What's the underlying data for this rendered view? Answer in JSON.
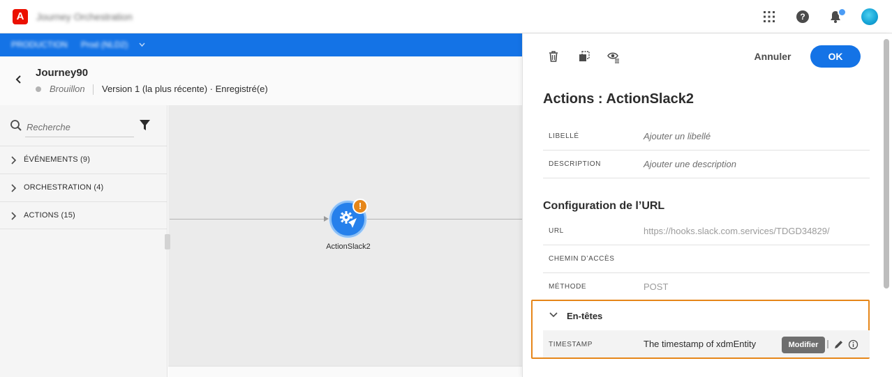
{
  "topbar": {
    "app_title": "Journey Orchestration",
    "help_glyph": "?"
  },
  "env_bar": {
    "environment": "PRODUCTION",
    "sandbox": "Prod (NLD2)"
  },
  "journey": {
    "name": "Journey90",
    "status": "Brouillon",
    "version": "Version 1 (la plus récente) · Enregistré(e)"
  },
  "palette": {
    "search_placeholder": "Recherche",
    "categories": [
      {
        "label": "ÉVÉNEMENTS (9)"
      },
      {
        "label": "ORCHESTRATION (4)"
      },
      {
        "label": "ACTIONS (15)"
      }
    ]
  },
  "canvas": {
    "node_label": "ActionSlack2",
    "node_warning_glyph": "!"
  },
  "panel": {
    "cancel_label": "Annuler",
    "ok_label": "OK",
    "title": "Actions : ActionSlack2",
    "fields": {
      "label_key": "LIBELLÉ",
      "label_value": "Ajouter un libellé",
      "description_key": "DESCRIPTION",
      "description_value": "Ajouter une description"
    },
    "url_section_title": "Configuration de l’URL",
    "url_fields": {
      "url_key": "URL",
      "url_value": "https://hooks.slack.com.services/TDGD34829/",
      "path_key": "CHEMIN D’ACCÈS",
      "path_value": "",
      "method_key": "MÉTHODE",
      "method_value": "POST"
    },
    "headers": {
      "title": "En-têtes",
      "key": "TIMESTAMP",
      "value": "The timestamp of xdmEntity",
      "tooltip": "Modifier"
    }
  },
  "colors": {
    "accent_blue": "#1473e6",
    "warning_orange": "#e68619",
    "adobe_red": "#eb1000"
  }
}
